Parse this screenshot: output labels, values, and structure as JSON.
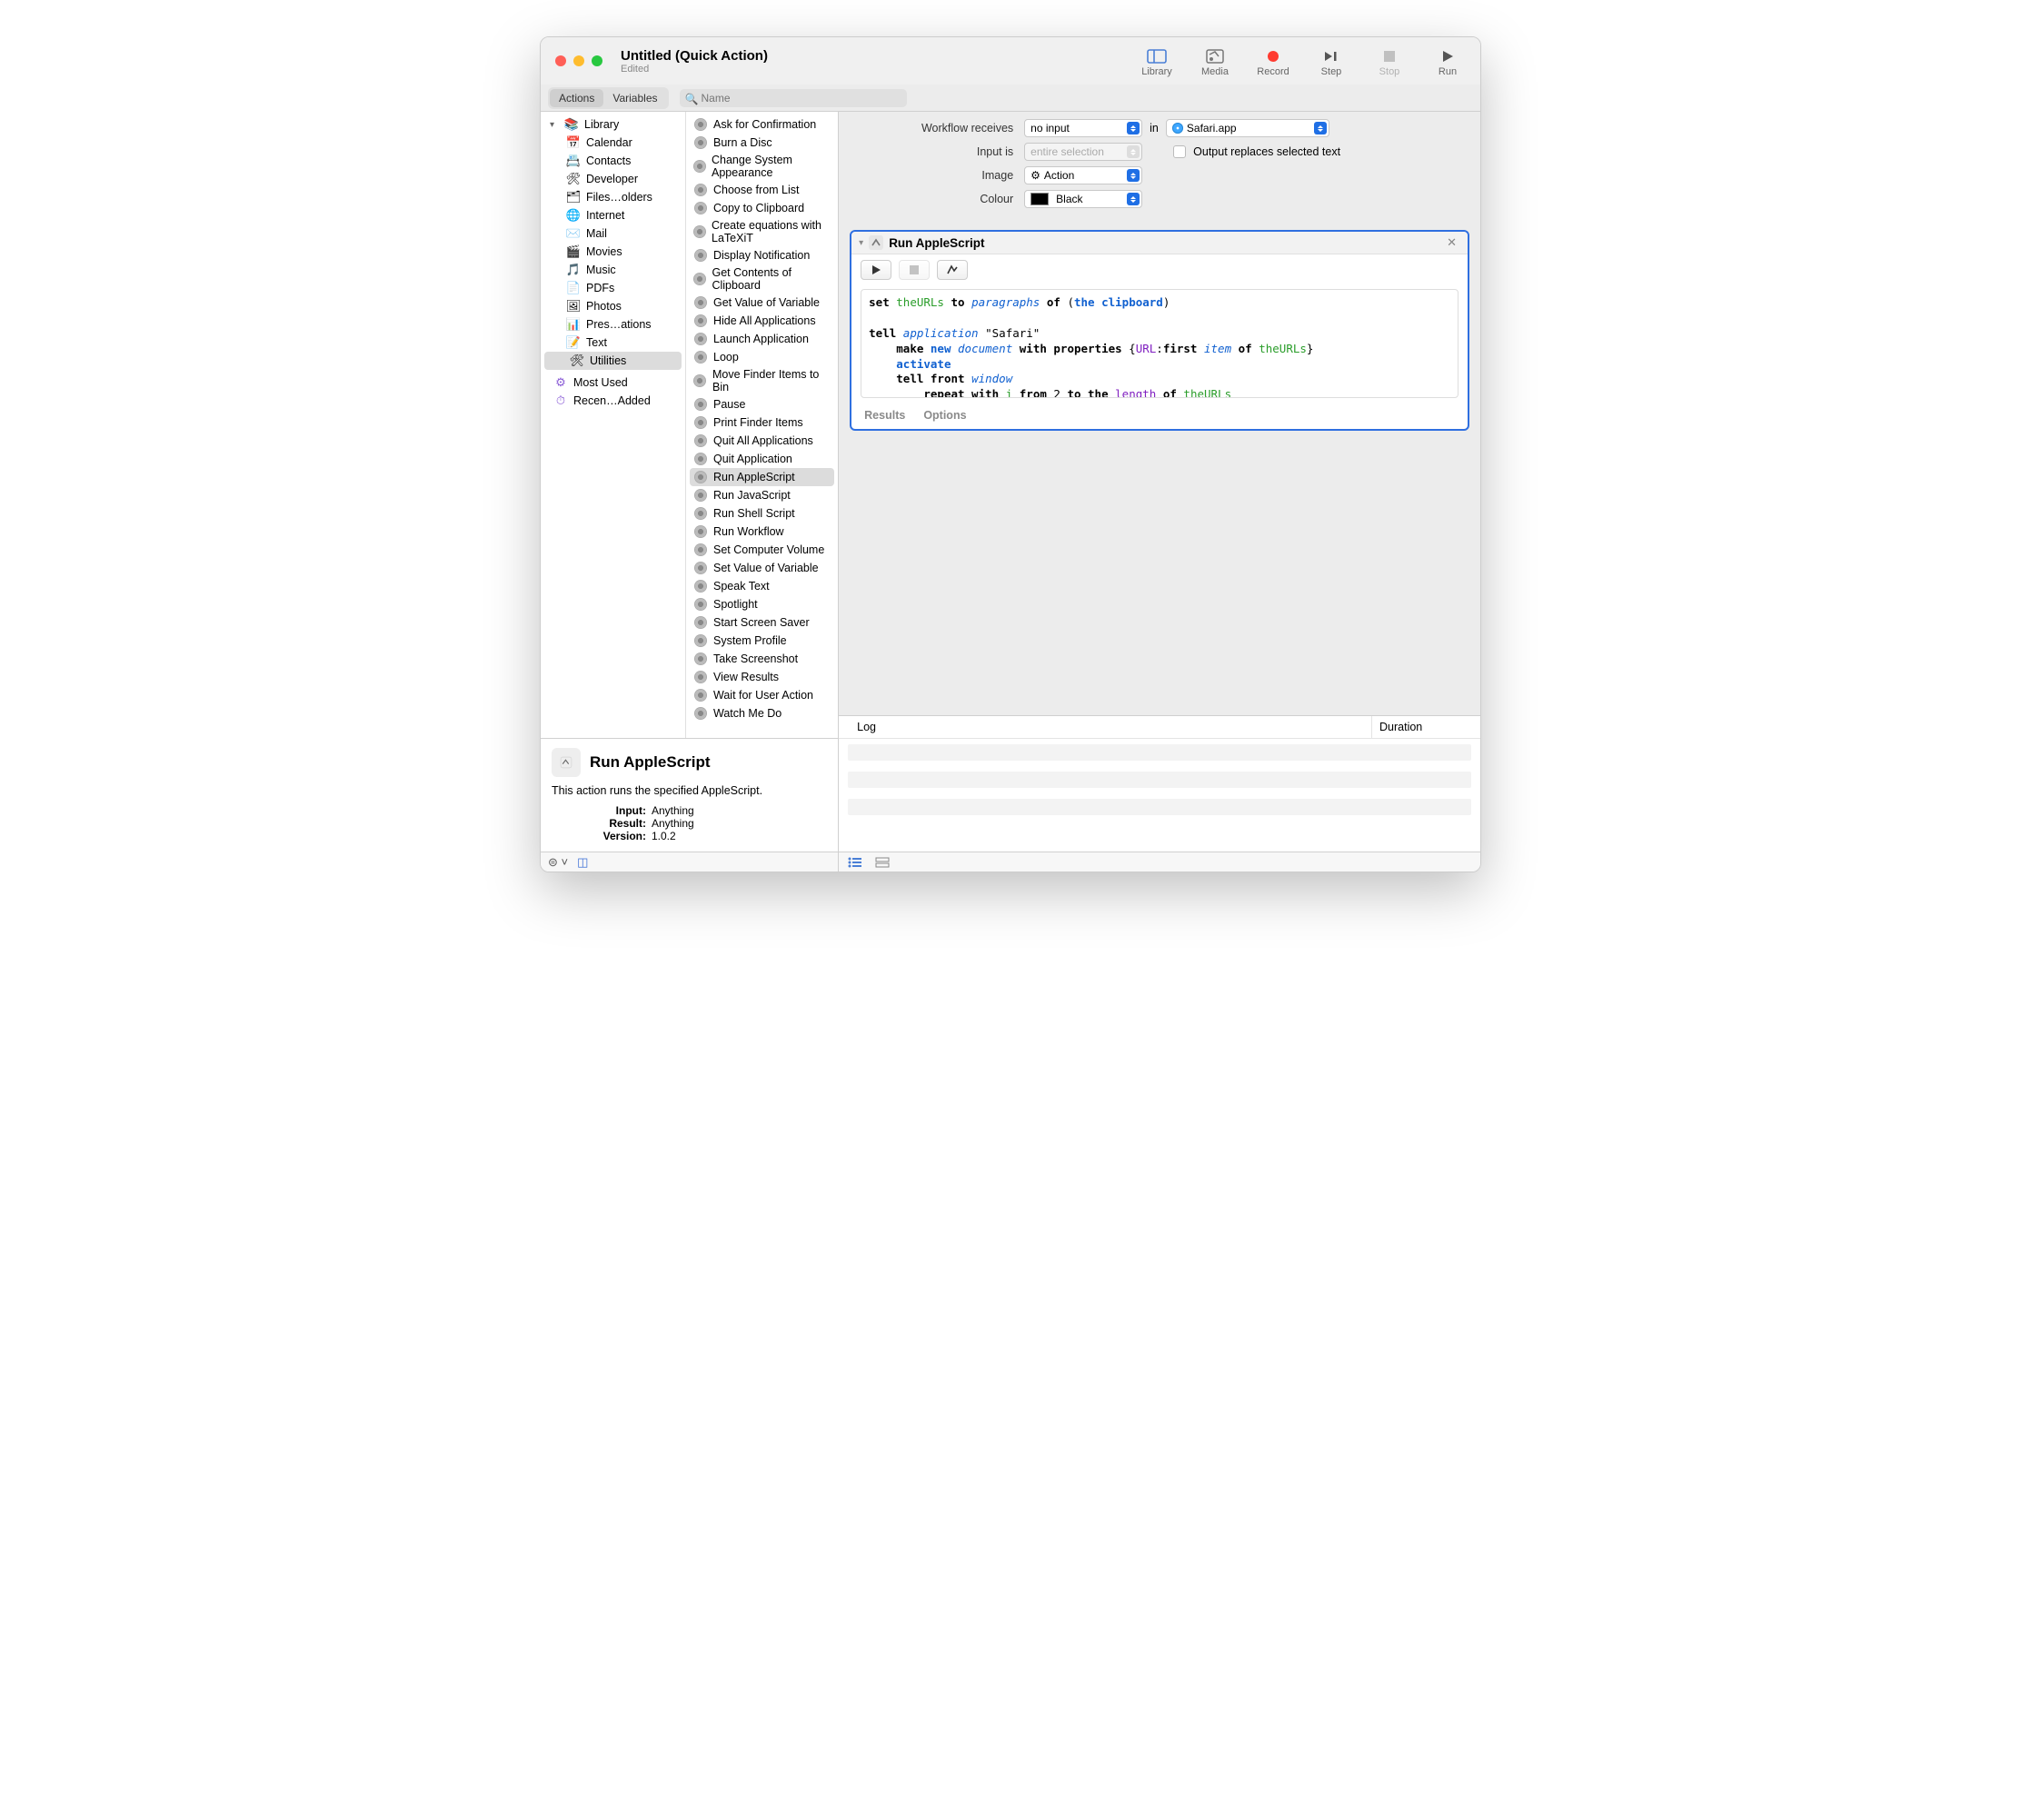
{
  "window": {
    "title": "Untitled (Quick Action)",
    "subtitle": "Edited"
  },
  "toolbar": {
    "library": "Library",
    "media": "Media",
    "record": "Record",
    "step": "Step",
    "stop": "Stop",
    "run": "Run"
  },
  "segments": {
    "actions": "Actions",
    "variables": "Variables"
  },
  "search": {
    "placeholder": "Name"
  },
  "library": {
    "root": "Library",
    "items": [
      {
        "label": "Calendar",
        "icon": "📅"
      },
      {
        "label": "Contacts",
        "icon": "📇"
      },
      {
        "label": "Developer",
        "icon": "🛠"
      },
      {
        "label": "Files…olders",
        "icon": "🗂"
      },
      {
        "label": "Internet",
        "icon": "🌐"
      },
      {
        "label": "Mail",
        "icon": "✉️"
      },
      {
        "label": "Movies",
        "icon": "🎬"
      },
      {
        "label": "Music",
        "icon": "🎵"
      },
      {
        "label": "PDFs",
        "icon": "📄"
      },
      {
        "label": "Photos",
        "icon": "🖼"
      },
      {
        "label": "Pres…ations",
        "icon": "📊"
      },
      {
        "label": "Text",
        "icon": "📝"
      },
      {
        "label": "Utilities",
        "icon": "🛠",
        "selected": true
      }
    ],
    "smart": [
      {
        "label": "Most Used",
        "icon": "⚙︎"
      },
      {
        "label": "Recen…Added",
        "icon": "⏱"
      }
    ]
  },
  "actions": [
    "Ask for Confirmation",
    "Burn a Disc",
    "Change System Appearance",
    "Choose from List",
    "Copy to Clipboard",
    "Create equations with LaTeXiT",
    "Display Notification",
    "Get Contents of Clipboard",
    "Get Value of Variable",
    "Hide All Applications",
    "Launch Application",
    "Loop",
    "Move Finder Items to Bin",
    "Pause",
    "Print Finder Items",
    "Quit All Applications",
    "Quit Application",
    "Run AppleScript",
    "Run JavaScript",
    "Run Shell Script",
    "Run Workflow",
    "Set Computer Volume",
    "Set Value of Variable",
    "Speak Text",
    "Spotlight",
    "Start Screen Saver",
    "System Profile",
    "Take Screenshot",
    "View Results",
    "Wait for User Action",
    "Watch Me Do"
  ],
  "actions_selected_index": 17,
  "info": {
    "title": "Run AppleScript",
    "desc": "This action runs the specified AppleScript.",
    "input_k": "Input:",
    "input_v": "Anything",
    "result_k": "Result:",
    "result_v": "Anything",
    "version_k": "Version:",
    "version_v": "1.0.2"
  },
  "workflow_header": {
    "receives_label": "Workflow receives",
    "receives_value": "no input",
    "in_label": "in",
    "in_value": "Safari.app",
    "inputis_label": "Input is",
    "inputis_value": "entire selection",
    "replaces_label": "Output replaces selected text",
    "image_label": "Image",
    "image_value": "Action",
    "colour_label": "Colour",
    "colour_value": "Black"
  },
  "action_card": {
    "title": "Run AppleScript",
    "footer_results": "Results",
    "footer_options": "Options"
  },
  "log": {
    "col1": "Log",
    "col2": "Duration"
  }
}
